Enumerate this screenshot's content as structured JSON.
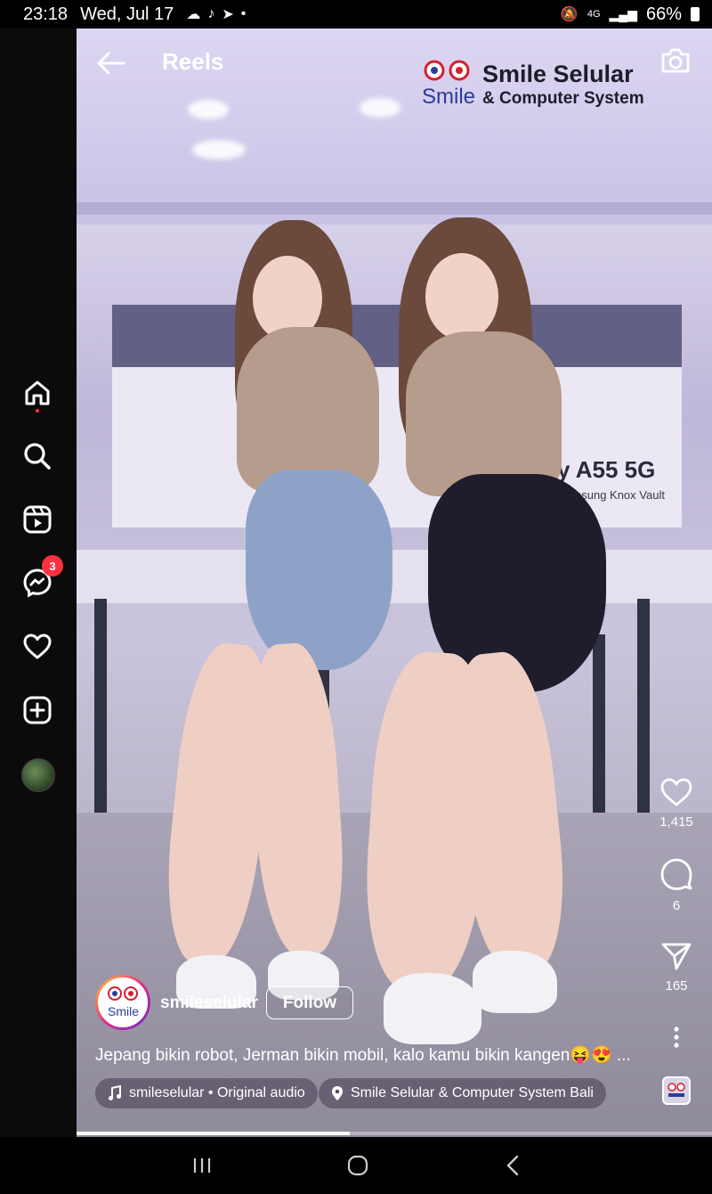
{
  "status_bar": {
    "time": "23:18",
    "date": "Wed, Jul 17",
    "network": "4G",
    "battery": "66%"
  },
  "nav_rail": {
    "items": [
      {
        "name": "home",
        "icon": "home-icon"
      },
      {
        "name": "search",
        "icon": "search-icon"
      },
      {
        "name": "reels",
        "icon": "reels-icon"
      },
      {
        "name": "messenger",
        "icon": "messenger-icon",
        "badge": "3"
      },
      {
        "name": "activity",
        "icon": "heart-icon"
      },
      {
        "name": "create",
        "icon": "plus-square-icon"
      },
      {
        "name": "profile",
        "icon": "avatar"
      }
    ]
  },
  "header": {
    "title": "Reels"
  },
  "watermark": {
    "logo_text": "Smile",
    "title": "Smile Selular",
    "subtitle": "& Computer System"
  },
  "scene": {
    "banner_text": "y A55 5G",
    "banner_sub": "esung Knox Vault"
  },
  "actions": {
    "likes": "1,415",
    "comments": "6",
    "shares": "165"
  },
  "post": {
    "avatar_text": "Smile",
    "username": "smileselular",
    "follow_label": "Follow",
    "caption": "Jepang bikin robot, Jerman bikin mobil, kalo kamu bikin kangen😝😍 ...",
    "audio": "smileselular • Original audio",
    "location": "Smile Selular & Computer System Bali",
    "progress": 0.43
  },
  "colors": {
    "badge": "#ff3040",
    "rail_bg": "#0b0b0c"
  }
}
